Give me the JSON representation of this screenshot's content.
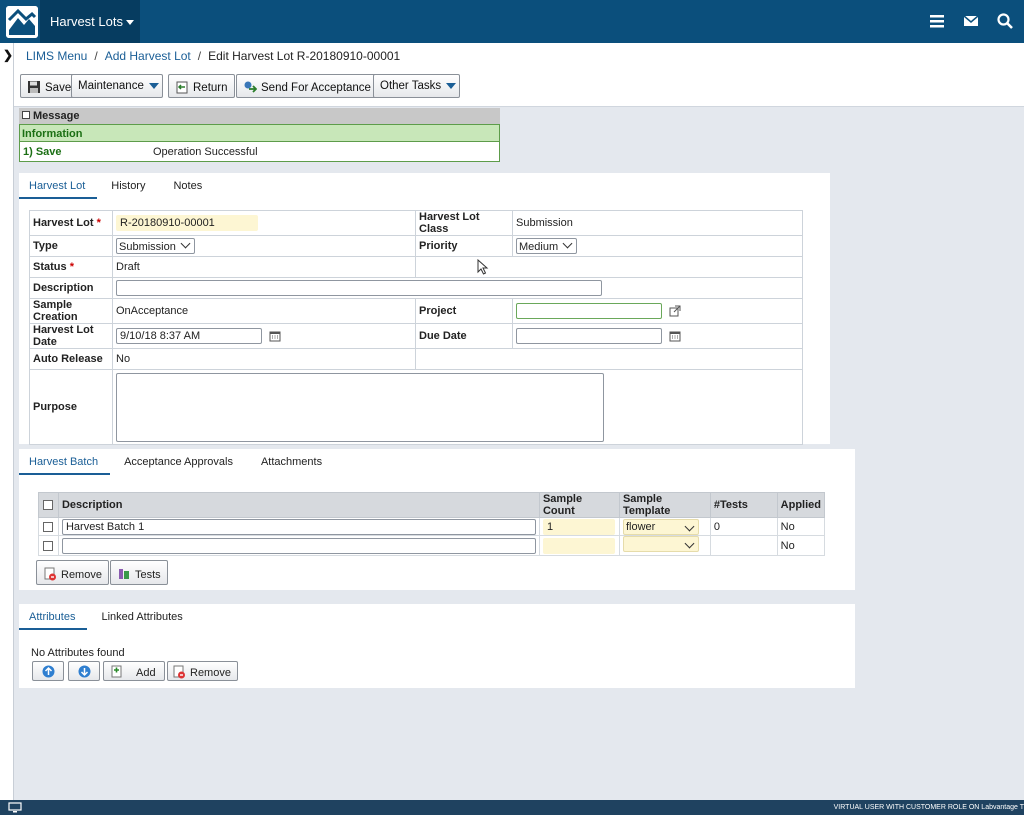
{
  "app": {
    "menu_label": "Harvest Lots"
  },
  "breadcrumb": {
    "root": "LIMS Menu",
    "parent": "Add Harvest Lot",
    "current": "Edit Harvest Lot R-20180910-00001"
  },
  "toolbar": {
    "save": "Save",
    "maintenance": "Maintenance",
    "return": "Return",
    "send_for_acceptance": "Send For Acceptance",
    "other_tasks": "Other Tasks"
  },
  "message": {
    "header": "Message",
    "level": "Information",
    "item_key": "1) Save",
    "item_value": "Operation Successful"
  },
  "top_tabs": [
    "Harvest Lot",
    "History",
    "Notes"
  ],
  "form": {
    "harvest_lot_label": "Harvest Lot",
    "harvest_lot_value": "R-20180910-00001",
    "harvest_lot_class_label": "Harvest Lot Class",
    "harvest_lot_class_value": "Submission",
    "type_label": "Type",
    "type_value": "Submission",
    "priority_label": "Priority",
    "priority_value": "Medium",
    "status_label": "Status",
    "status_value": "Draft",
    "description_label": "Description",
    "description_value": "",
    "sample_creation_label": "Sample Creation",
    "sample_creation_value": "OnAcceptance",
    "project_label": "Project",
    "project_value": "",
    "harvest_lot_date_label": "Harvest Lot Date",
    "harvest_lot_date_value": "9/10/18 8:37 AM",
    "due_date_label": "Due Date",
    "due_date_value": "",
    "auto_release_label": "Auto Release",
    "auto_release_value": "No",
    "purpose_label": "Purpose",
    "purpose_value": ""
  },
  "batch_tabs": [
    "Harvest Batch",
    "Acceptance Approvals",
    "Attachments"
  ],
  "batch_grid": {
    "columns": [
      "Description",
      "Sample Count",
      "Sample Template",
      "#Tests",
      "Applied"
    ],
    "rows": [
      {
        "description": "Harvest Batch 1",
        "sample_count": "1",
        "sample_template": "flower",
        "tests": "0",
        "applied": "No"
      },
      {
        "description": "",
        "sample_count": "",
        "sample_template": "",
        "tests": "",
        "applied": "No"
      }
    ],
    "remove_button": "Remove",
    "tests_button": "Tests"
  },
  "attr_tabs": [
    "Attributes",
    "Linked Attributes"
  ],
  "attributes": {
    "empty_text": "No Attributes found",
    "add_button": "Add",
    "remove_button": "Remove"
  },
  "status_bar": {
    "text": "VIRTUAL USER WITH CUSTOMER ROLE ON Labvantage T"
  },
  "colors": {
    "topbar": "#0b4f7c",
    "link": "#1a5e96",
    "info_green": "#c8e7b9",
    "field_yellow": "#fdf6d3"
  }
}
